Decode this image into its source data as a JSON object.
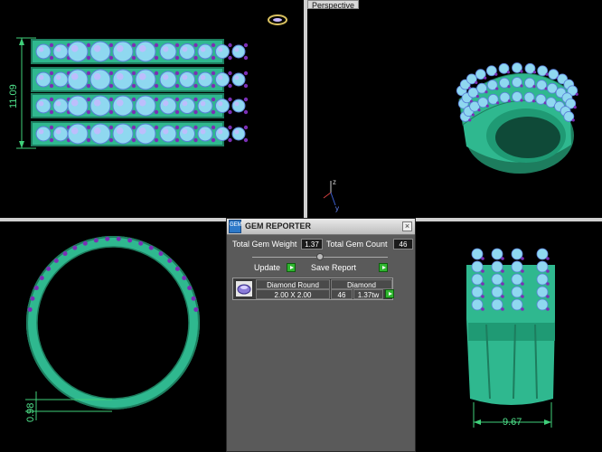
{
  "viewports": {
    "top": {
      "dimension_label": "11.09"
    },
    "perspective": {
      "label": "Perspective",
      "axis_z": "z",
      "axis_y": "y"
    },
    "left": {
      "dimension_label": "0.98"
    },
    "right": {
      "dimension_label": "9.67"
    }
  },
  "colors": {
    "ring": "#2fb88f",
    "ring_dark": "#1d7d5e",
    "gem": "#8fd8f0",
    "gem_highlight": "#c8b8ff",
    "prong": "#7b2fb5",
    "dimension": "#3fd07a",
    "panel_bg": "#5a5a5a",
    "go_button": "#2fb52f"
  },
  "gem_reporter": {
    "title": "GEM REPORTER",
    "logo_text": "GEM",
    "close_glyph": "×",
    "total_gem_weight_label": "Total Gem Weight",
    "total_gem_weight_value": "1.37",
    "total_gem_count_label": "Total Gem Count",
    "total_gem_count_value": "46",
    "update_label": "Update",
    "save_report_label": "Save Report",
    "table": {
      "col_shape": "Diamond Round",
      "col_material": "Diamond",
      "size": "2.00 X 2.00",
      "count": "46",
      "weight": "1.37tw"
    }
  }
}
